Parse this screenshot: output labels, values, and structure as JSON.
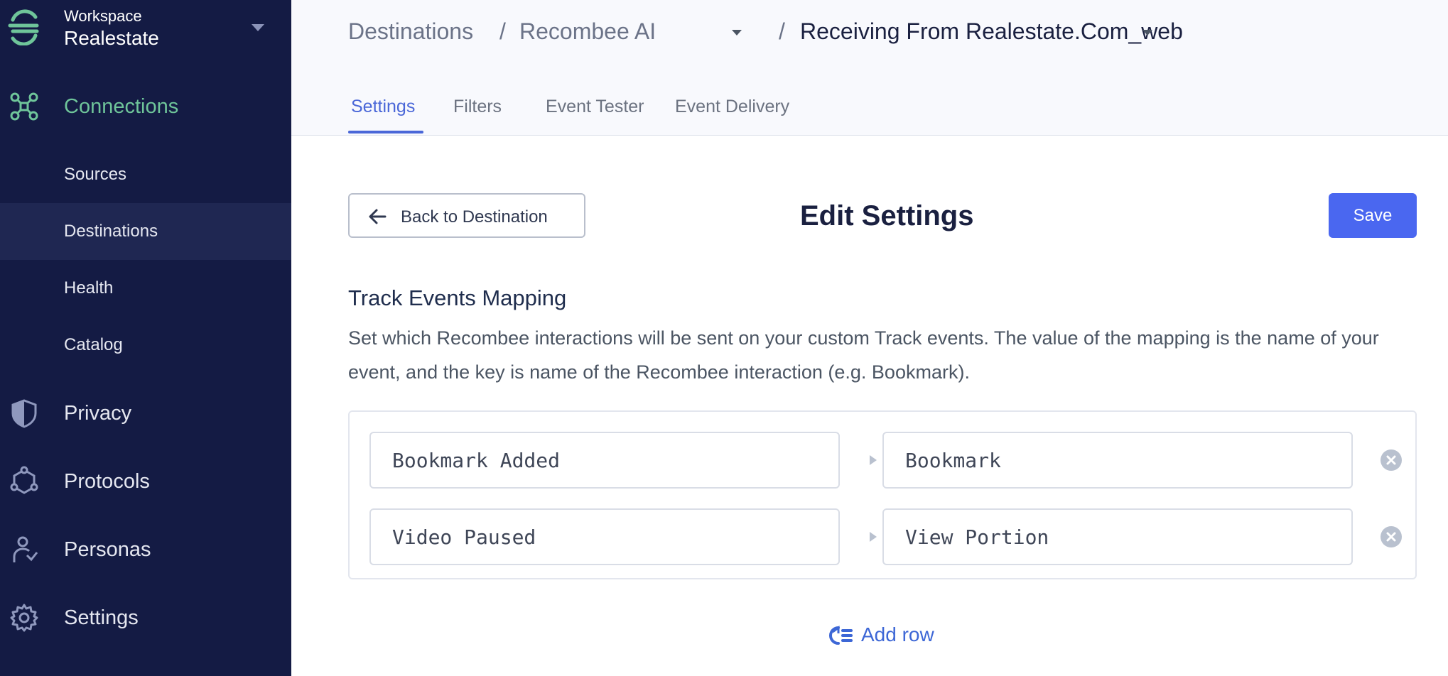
{
  "workspace": {
    "label": "Workspace",
    "name": "Realestate"
  },
  "sidebar": {
    "connections": "Connections",
    "sub_items": [
      "Sources",
      "Destinations",
      "Health",
      "Catalog"
    ],
    "privacy": "Privacy",
    "protocols": "Protocols",
    "personas": "Personas",
    "settings": "Settings"
  },
  "breadcrumb": {
    "root": "Destinations",
    "sep": "/",
    "destination": "Recombee AI",
    "current": "Receiving From Realestate.Com_web"
  },
  "tabs": [
    "Settings",
    "Filters",
    "Event Tester",
    "Event Delivery"
  ],
  "page": {
    "back_label": "Back to Destination",
    "title": "Edit Settings",
    "save_label": "Save"
  },
  "section": {
    "title": "Track Events Mapping",
    "description": "Set which Recombee interactions will be sent on your custom Track events. The value of the mapping is the name of your event, and the key is name of the Recombee interaction (e.g. Bookmark)."
  },
  "mappings": [
    {
      "event": "Bookmark Added",
      "interaction": "Bookmark"
    },
    {
      "event": "Video Paused",
      "interaction": "View Portion"
    }
  ],
  "add_row_label": "Add row",
  "colors": {
    "sidebar_bg": "#141b44",
    "accent": "#4a67f0",
    "connections_active": "#6fc59a",
    "link": "#3d67d6"
  }
}
